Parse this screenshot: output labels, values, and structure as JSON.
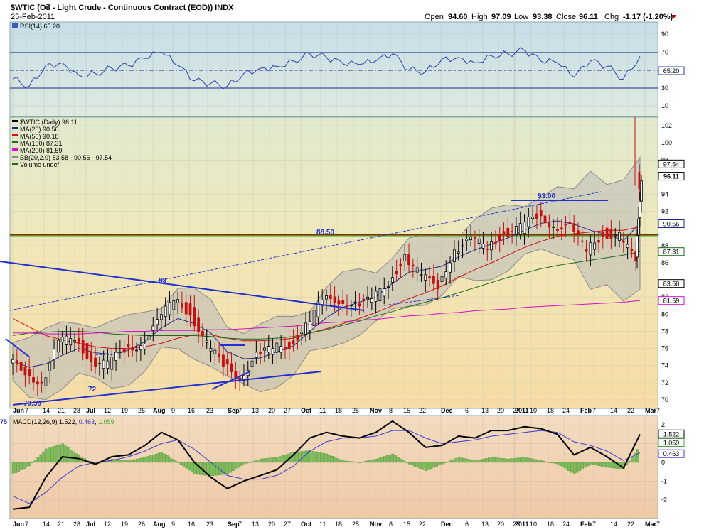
{
  "header": {
    "title": "$WTIC (Oil - Light Crude - Continuous Contract (EOD)) INDX",
    "date": "25-Feb-2011",
    "open_label": "Open",
    "open": "94.60",
    "high_label": "High",
    "high": "97.09",
    "low_label": "Low",
    "low": "93.38",
    "close_label": "Close",
    "close": "96.11",
    "chg_label": "Chg",
    "chg": "-1.17 (-1.20%)"
  },
  "rsi": {
    "label": "RSI(14) 65.20",
    "value_badge": "65.20",
    "ticks": [
      "90",
      "70",
      "50",
      "30",
      "10"
    ]
  },
  "price": {
    "legend": [
      {
        "text": "$WTIC (Daily) 96.11",
        "color": "#000000"
      },
      {
        "text": "MA(20) 90.56",
        "color": "#1a2a8c"
      },
      {
        "text": "MA(50) 90.18",
        "color": "#d01010"
      },
      {
        "text": "MA(100) 87.31",
        "color": "#1d6b1d"
      },
      {
        "text": "MA(200) 81.59",
        "color": "#d010c8"
      },
      {
        "text": "BB(20,2.0) 83.58 - 90.56 - 97.54",
        "color": "#8a8a8a"
      },
      {
        "text": "Volume undef",
        "color": "#1d6b1d"
      }
    ],
    "ticks": [
      "102",
      "100",
      "98",
      "94",
      "92",
      "88",
      "86",
      "82",
      "80",
      "78",
      "76",
      "74",
      "72",
      "70"
    ],
    "badges": [
      {
        "text": "97.54",
        "bg": "#ffffff",
        "fg": "#000000"
      },
      {
        "text": "96.11",
        "bg": "#ffffff",
        "fg": "#000000"
      },
      {
        "text": "90.56",
        "bg": "#ffffff",
        "fg": "#1a2a8c"
      },
      {
        "text": "87.31",
        "bg": "#ffffff",
        "fg": "#1d6b1d"
      },
      {
        "text": "83.58",
        "bg": "#ffffff",
        "fg": "#000000"
      },
      {
        "text": "81.59",
        "bg": "#ffffff",
        "fg": "#d010c8"
      }
    ],
    "annotations": [
      "88.50",
      "93.00",
      "83",
      "72",
      "70.50"
    ]
  },
  "macd": {
    "label": "MACD(12,26,9) 1.522, 0.463, 1.059",
    "label_parts": [
      "MACD(12,26,9) ",
      "1.522",
      ", ",
      "0.463",
      ", ",
      "1.059"
    ],
    "left_cut": "75",
    "ticks": [
      "2",
      "1",
      "0",
      "-1",
      "-2"
    ],
    "badges": [
      "1.522",
      "1.059",
      "0.463"
    ]
  },
  "x_axis": {
    "labels": [
      "Jun",
      "7",
      "14",
      "21",
      "28",
      "Jul",
      "12",
      "19",
      "26",
      "Aug",
      "9",
      "16",
      "23",
      "Sep",
      "7",
      "13",
      "20",
      "27",
      "Oct",
      "11",
      "18",
      "25",
      "Nov",
      "8",
      "15",
      "22",
      "Dec",
      "6",
      "13",
      "20",
      "27",
      "2011",
      "10",
      "18",
      "24",
      "Feb",
      "7",
      "14",
      "22",
      "Mar",
      "7"
    ],
    "bold": [
      "Jun",
      "Jul",
      "Aug",
      "Sep",
      "Oct",
      "Nov",
      "Dec",
      "2011",
      "Feb",
      "Mar"
    ]
  },
  "chart_data": {
    "type": "line",
    "title": "$WTIC (Oil - Light Crude - Continuous Contract (EOD)) INDX",
    "x": [
      "2010-06-01",
      "2010-06-07",
      "2010-06-14",
      "2010-06-21",
      "2010-06-28",
      "2010-07-06",
      "2010-07-12",
      "2010-07-19",
      "2010-07-26",
      "2010-08-02",
      "2010-08-09",
      "2010-08-16",
      "2010-08-23",
      "2010-08-30",
      "2010-09-07",
      "2010-09-13",
      "2010-09-20",
      "2010-09-27",
      "2010-10-04",
      "2010-10-11",
      "2010-10-18",
      "2010-10-25",
      "2010-11-01",
      "2010-11-08",
      "2010-11-15",
      "2010-11-22",
      "2010-11-29",
      "2010-12-06",
      "2010-12-13",
      "2010-12-20",
      "2010-12-27",
      "2011-01-03",
      "2011-01-10",
      "2011-01-18",
      "2011-01-24",
      "2011-01-31",
      "2011-02-07",
      "2011-02-14",
      "2011-02-22"
    ],
    "series": [
      {
        "name": "$WTIC (Daily) 96.11",
        "values": [
          73.5,
          71.8,
          76.5,
          77.5,
          74.5,
          74.0,
          76.0,
          76.5,
          78.8,
          81.9,
          80.2,
          76.3,
          74.1,
          72.8,
          75.0,
          76.0,
          76.5,
          78.5,
          81.5,
          81.8,
          81.1,
          81.5,
          83.8,
          86.8,
          84.2,
          83.5,
          87.5,
          88.5,
          88.0,
          89.5,
          90.0,
          91.5,
          90.5,
          90.0,
          87.5,
          89.5,
          89.0,
          86.2,
          96.1
        ]
      },
      {
        "name": "MA(20) 90.56",
        "values": [
          74.5,
          73.8,
          74.2,
          75.2,
          76.0,
          75.5,
          75.3,
          75.8,
          76.8,
          78.4,
          79.5,
          78.9,
          77.8,
          75.6,
          74.8,
          74.9,
          75.6,
          76.3,
          78.0,
          79.6,
          80.8,
          81.4,
          82.0,
          83.6,
          84.9,
          85.2,
          85.6,
          86.7,
          87.5,
          88.2,
          88.9,
          89.8,
          90.6,
          90.9,
          90.5,
          89.8,
          89.3,
          88.6,
          90.6
        ]
      },
      {
        "name": "MA(50) 90.18",
        "values": [
          79.5,
          78.5,
          77.5,
          77.0,
          76.6,
          76.2,
          76.0,
          76.0,
          76.2,
          76.6,
          77.2,
          77.6,
          77.6,
          77.2,
          76.9,
          76.9,
          77.0,
          77.2,
          77.8,
          78.3,
          78.9,
          79.5,
          80.2,
          81.0,
          81.8,
          82.5,
          83.3,
          84.3,
          85.2,
          86.0,
          86.9,
          87.8,
          88.5,
          89.1,
          89.4,
          89.6,
          89.8,
          89.8,
          90.2
        ]
      },
      {
        "name": "MA(100) 87.31",
        "values": [
          77.5,
          77.8,
          77.9,
          78.0,
          78.0,
          77.9,
          77.7,
          77.6,
          77.5,
          77.5,
          77.5,
          77.5,
          77.4,
          77.2,
          77.1,
          77.1,
          77.2,
          77.4,
          77.8,
          78.2,
          78.7,
          79.2,
          79.8,
          80.3,
          80.9,
          81.4,
          81.9,
          82.5,
          83.1,
          83.7,
          84.3,
          84.8,
          85.3,
          85.7,
          86.0,
          86.3,
          86.6,
          86.9,
          87.3
        ]
      },
      {
        "name": "MA(200) 81.59",
        "values": [
          77.8,
          77.8,
          77.7,
          77.7,
          77.7,
          77.8,
          77.9,
          78.0,
          78.0,
          78.1,
          78.1,
          78.1,
          78.2,
          78.2,
          78.3,
          78.4,
          78.5,
          78.6,
          78.8,
          79.0,
          79.1,
          79.3,
          79.4,
          79.6,
          79.8,
          79.9,
          80.1,
          80.2,
          80.4,
          80.5,
          80.6,
          80.8,
          80.9,
          81.0,
          81.1,
          81.2,
          81.3,
          81.4,
          81.6
        ]
      }
    ],
    "rsi": [
      40,
      32,
      55,
      58,
      44,
      46,
      52,
      55,
      63,
      70,
      55,
      38,
      35,
      32,
      46,
      52,
      54,
      60,
      68,
      64,
      57,
      56,
      60,
      68,
      50,
      48,
      62,
      64,
      58,
      66,
      68,
      72,
      60,
      58,
      42,
      60,
      54,
      40,
      65.2
    ],
    "macd": [
      -2.5,
      -2.4,
      -0.8,
      0.3,
      0.2,
      -0.1,
      0.3,
      0.4,
      0.9,
      1.6,
      1.2,
      0.0,
      -0.8,
      -1.4,
      -1.0,
      -0.7,
      -0.4,
      0.4,
      1.3,
      1.6,
      1.4,
      1.3,
      1.6,
      2.2,
      1.6,
      0.8,
      0.9,
      1.4,
      1.3,
      1.7,
      1.7,
      1.9,
      1.8,
      1.5,
      0.4,
      0.8,
      0.3,
      -0.3,
      1.5
    ],
    "signal": [
      -1.8,
      -2.2,
      -1.6,
      -0.8,
      -0.2,
      0.0,
      0.1,
      0.3,
      0.6,
      1.0,
      1.2,
      0.7,
      0.0,
      -0.7,
      -0.9,
      -0.9,
      -0.7,
      -0.2,
      0.6,
      1.1,
      1.3,
      1.3,
      1.4,
      1.7,
      1.7,
      1.3,
      1.0,
      1.1,
      1.2,
      1.4,
      1.5,
      1.6,
      1.7,
      1.6,
      1.1,
      0.9,
      0.6,
      0.1,
      0.5
    ],
    "price_ylim": [
      69,
      103
    ],
    "rsi_ylim": [
      0,
      100
    ],
    "macd_ylim": [
      -3,
      2.5
    ],
    "grid": true,
    "legend_position": "top-left"
  }
}
